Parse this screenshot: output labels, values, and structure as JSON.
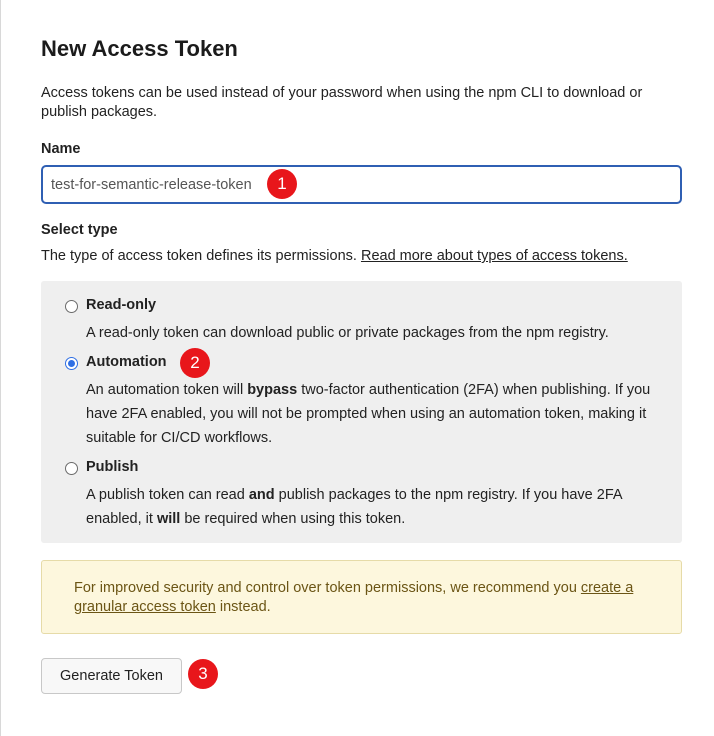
{
  "page": {
    "title": "New Access Token",
    "intro": "Access tokens can be used instead of your password when using the npm CLI to download or publish packages."
  },
  "name_field": {
    "label": "Name",
    "value": "test-for-semantic-release-token"
  },
  "select_type": {
    "label": "Select type",
    "description": "The type of access token defines its permissions. ",
    "link_text": "Read more about types of access tokens."
  },
  "options": [
    {
      "title": "Read-only",
      "checked": false,
      "desc": [
        "A read-only token can download public or private packages from the npm registry."
      ]
    },
    {
      "title": "Automation",
      "checked": true,
      "desc_parts": {
        "a": "An automation token will ",
        "b": "bypass",
        "c": " two-factor authentication (2FA) when publishing. If you have 2FA enabled, you will not be prompted when using an automation token, making it suitable for CI/CD workflows."
      }
    },
    {
      "title": "Publish",
      "checked": false,
      "desc_parts": {
        "a": "A publish token can read ",
        "b": "and",
        "c": " publish packages to the npm registry. If you have 2FA enabled, it ",
        "d": "will",
        "e": " be required when using this token."
      }
    }
  ],
  "notice": {
    "text": "For improved security and control over token permissions, we recommend you ",
    "link_text": "create a granular access token",
    "suffix": " instead."
  },
  "generate_button": {
    "label": "Generate Token"
  },
  "annotations": [
    "1",
    "2",
    "3"
  ],
  "colors": {
    "input_border": "#2f5fb3",
    "radio_checked": "#2f6fe4",
    "badge": "#e8161b",
    "notice_bg": "#fdf7dd"
  }
}
